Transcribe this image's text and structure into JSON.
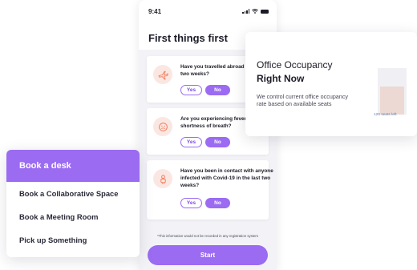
{
  "phone": {
    "status_time": "9:41",
    "title": "First things first",
    "questions": [
      {
        "text": "Have you travelled abroad in the last two weeks?",
        "icon": "airplane-icon",
        "yes": "Yes",
        "no": "No"
      },
      {
        "text": "Are you experiencing fever, cough or shortness of breath?",
        "icon": "sick-face-icon",
        "yes": "Yes",
        "no": "No"
      },
      {
        "text": "Have you been in contact with anyone infected with Covid-19 in the last two weeks?",
        "icon": "person-icon",
        "yes": "Yes",
        "no": "No"
      }
    ],
    "disclaimer": "*This information would not be recorded in any registration system",
    "start_label": "Start"
  },
  "occupancy": {
    "title_line1": "Office Occupancy",
    "title_line2": "Right Now",
    "description": "We control current office occupancy rate based on available seats",
    "seats_left": "120 seats left",
    "occupancy_fraction": 0.6
  },
  "booking": {
    "header": "Book a desk",
    "items": [
      "Book a Collaborative Space",
      "Book a Meeting Room",
      "Pick up Something"
    ]
  },
  "colors": {
    "accent": "#9b6bf2",
    "icon_bg": "#fbe7e2",
    "icon_stroke": "#f07b5d"
  }
}
